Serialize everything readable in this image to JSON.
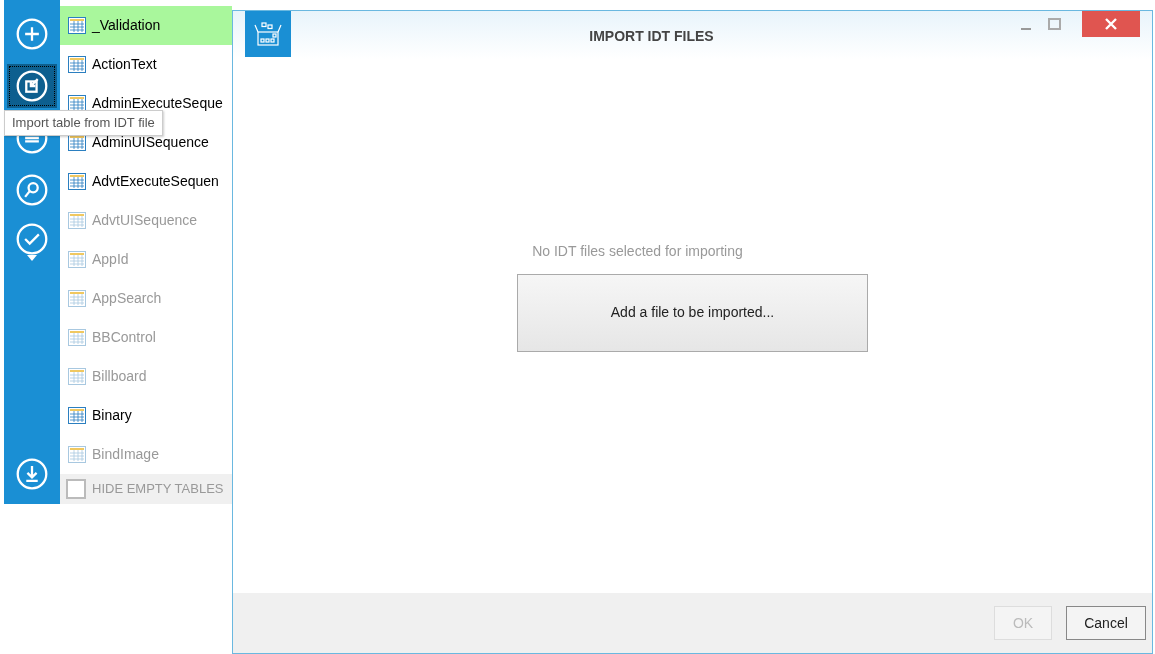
{
  "toolbar": {
    "items": [
      {
        "kind": "add",
        "selected": false
      },
      {
        "kind": "import",
        "selected": true
      },
      {
        "kind": "list",
        "selected": false
      },
      {
        "kind": "search",
        "selected": false
      },
      {
        "kind": "validate",
        "selected": false
      }
    ],
    "bottom": {
      "kind": "export",
      "selected": false
    }
  },
  "tooltip": {
    "text": "Import table from IDT file"
  },
  "tables": {
    "items": [
      {
        "name": "_Validation",
        "selected": true,
        "empty": false
      },
      {
        "name": "ActionText",
        "selected": false,
        "empty": false
      },
      {
        "name": "AdminExecuteSeque",
        "selected": false,
        "empty": false
      },
      {
        "name": "AdminUISequence",
        "selected": false,
        "empty": false
      },
      {
        "name": "AdvtExecuteSequen",
        "selected": false,
        "empty": false
      },
      {
        "name": "AdvtUISequence",
        "selected": false,
        "empty": true
      },
      {
        "name": "AppId",
        "selected": false,
        "empty": true
      },
      {
        "name": "AppSearch",
        "selected": false,
        "empty": true
      },
      {
        "name": "BBControl",
        "selected": false,
        "empty": true
      },
      {
        "name": "Billboard",
        "selected": false,
        "empty": true
      },
      {
        "name": "Binary",
        "selected": false,
        "empty": false
      },
      {
        "name": "BindImage",
        "selected": false,
        "empty": true
      }
    ],
    "hide_empty": {
      "label": "HIDE EMPTY TABLES",
      "checked": false
    }
  },
  "dialog": {
    "title": "IMPORT IDT FILES",
    "message": "No IDT files selected for importing",
    "add_button": "Add a file to be imported...",
    "buttons": [
      {
        "label": "OK",
        "disabled": true
      },
      {
        "label": "Cancel",
        "disabled": false
      }
    ]
  }
}
